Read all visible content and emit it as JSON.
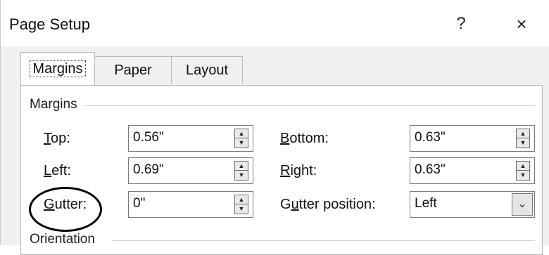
{
  "window": {
    "title": "Page Setup",
    "help_label": "?",
    "close_label": "×"
  },
  "tabs": [
    {
      "label": "Margins",
      "active": true
    },
    {
      "label": "Paper",
      "active": false
    },
    {
      "label": "Layout",
      "active": false
    }
  ],
  "margins": {
    "group_label": "Margins",
    "top": {
      "label": "Top:",
      "value": "0.56\""
    },
    "bottom": {
      "label": "Bottom:",
      "value": "0.63\""
    },
    "left": {
      "label": "Left:",
      "value": "0.69\""
    },
    "right": {
      "label": "Right:",
      "value": "0.63\""
    },
    "gutter": {
      "label": "Gutter:",
      "value": "0\""
    },
    "gutter_position": {
      "label": "Gutter position:",
      "value": "Left"
    }
  },
  "orientation": {
    "group_label": "Orientation"
  },
  "icons": {
    "spin_up": "▲",
    "spin_down": "▼",
    "dropdown": "⌄"
  }
}
